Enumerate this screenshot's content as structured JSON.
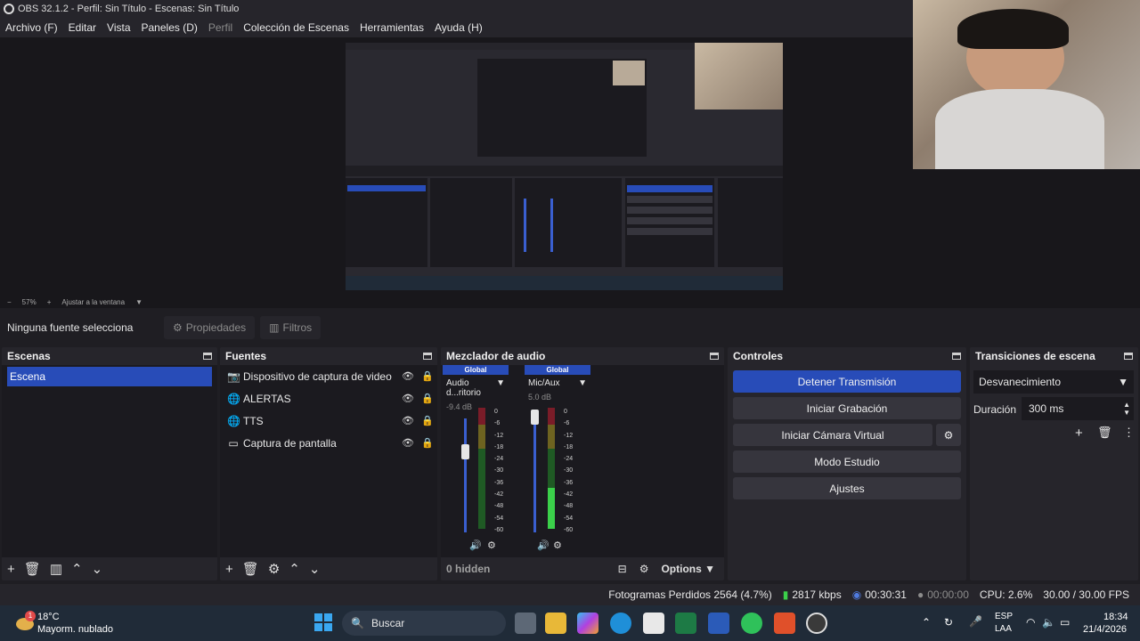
{
  "window": {
    "title": "OBS 32.1.2 - Perfil: Sin Título - Escenas: Sin Título"
  },
  "menu": {
    "items": [
      {
        "label": "Archivo (F)",
        "enabled": true
      },
      {
        "label": "Editar",
        "enabled": true
      },
      {
        "label": "Vista",
        "enabled": true
      },
      {
        "label": "Paneles (D)",
        "enabled": true
      },
      {
        "label": "Perfil",
        "enabled": false
      },
      {
        "label": "Colección de Escenas",
        "enabled": true
      },
      {
        "label": "Herramientas",
        "enabled": true
      },
      {
        "label": "Ayuda (H)",
        "enabled": true
      }
    ]
  },
  "preview": {
    "zoom": "57%",
    "fit_label": "Ajustar a la ventana"
  },
  "context": {
    "label": "Ninguna fuente selecciona",
    "properties": "Propiedades",
    "filters": "Filtros"
  },
  "scenes": {
    "title": "Escenas",
    "items": [
      "Escena"
    ]
  },
  "sources": {
    "title": "Fuentes",
    "items": [
      {
        "label": "Dispositivo de captura de video",
        "icon": "camera-icon"
      },
      {
        "label": "ALERTAS",
        "icon": "globe-icon"
      },
      {
        "label": "TTS",
        "icon": "globe-icon"
      },
      {
        "label": "Captura de pantalla",
        "icon": "monitor-icon"
      }
    ]
  },
  "mixer": {
    "title": "Mezclador de audio",
    "channels": [
      {
        "badge": "Global",
        "name": "Audio d...ritorio",
        "db": "-9.4 dB",
        "fader_level": 0.68
      },
      {
        "badge": "Global",
        "name": "Mic/Aux",
        "db": "5.0 dB",
        "fader_level": 0.93
      }
    ],
    "scale": [
      "0",
      "-6",
      "-12",
      "-18",
      "-24",
      "-30",
      "-36",
      "-42",
      "-48",
      "-54",
      "-60"
    ],
    "hidden": "0 hidden",
    "options": "Options"
  },
  "controls": {
    "title": "Controles",
    "stop_stream": "Detener Transmisión",
    "start_recording": "Iniciar Grabación",
    "start_virtual_cam": "Iniciar Cámara Virtual",
    "studio_mode": "Modo Estudio",
    "settings": "Ajustes"
  },
  "transitions": {
    "title": "Transiciones de escena",
    "selected": "Desvanecimiento",
    "duration_label": "Duración",
    "duration_value": "300 ms"
  },
  "status": {
    "dropped": "Fotogramas Perdidos 2564 (4.7%)",
    "bitrate": "2817 kbps",
    "stream_time": "00:30:31",
    "rec_time": "00:00:00",
    "cpu": "CPU: 2.6%",
    "fps": "30.00 / 30.00 FPS"
  },
  "taskbar": {
    "weather_temp": "18°C",
    "weather_desc": "Mayorm. nublado",
    "weather_badge": "1",
    "search": "Buscar",
    "lang_1": "ESP",
    "lang_2": "LAA",
    "time": "18:34",
    "date": "21/4/2026"
  },
  "colors": {
    "accent": "#284cb8",
    "panel": "#26252b",
    "bg": "#1f1e23"
  }
}
